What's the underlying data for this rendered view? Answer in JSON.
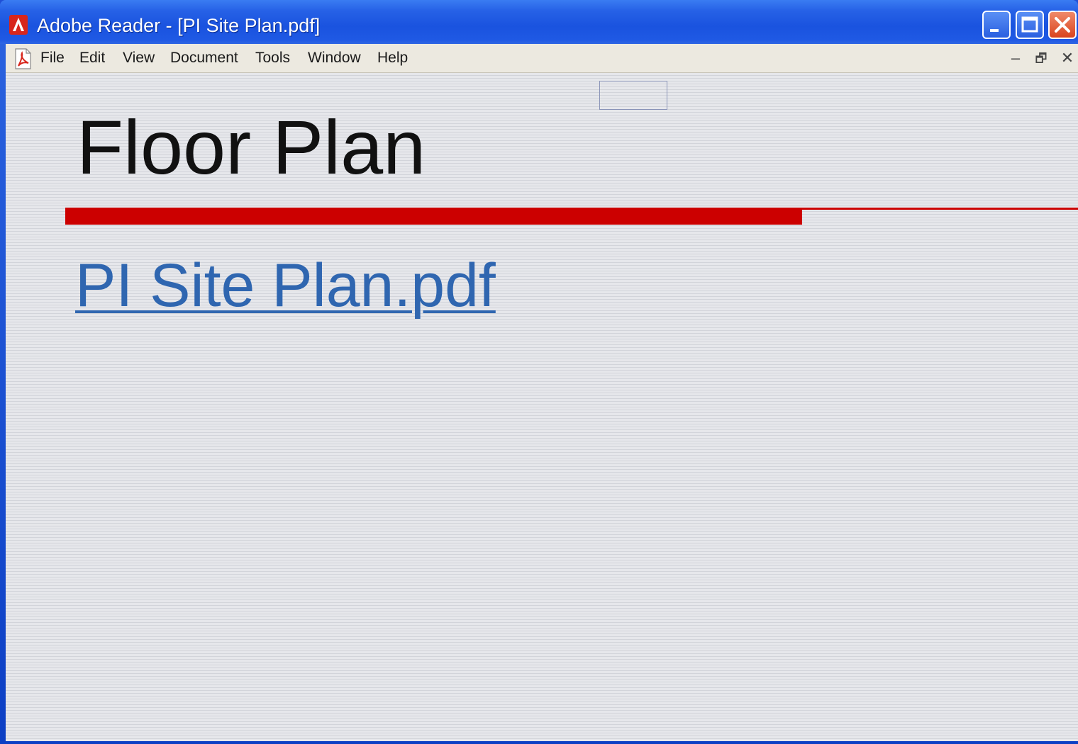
{
  "window": {
    "title": "Adobe Reader - [PI Site Plan.pdf]",
    "icon": "adobe-reader-icon"
  },
  "menubar": {
    "doc_icon": "pdf-document-icon",
    "items": [
      {
        "label": "File"
      },
      {
        "label": "Edit"
      },
      {
        "label": "View"
      },
      {
        "label": "Document"
      },
      {
        "label": "Tools"
      },
      {
        "label": "Window"
      },
      {
        "label": "Help"
      }
    ],
    "doc_controls": {
      "minimize": "–",
      "restore": "🗗",
      "close": "✕"
    }
  },
  "document": {
    "heading": "Floor Plan",
    "link_text": "PI Site Plan.pdf"
  },
  "colors": {
    "accent_bar": "#cc0000",
    "link": "#2f66b0",
    "titlebar": "#1a53df"
  }
}
